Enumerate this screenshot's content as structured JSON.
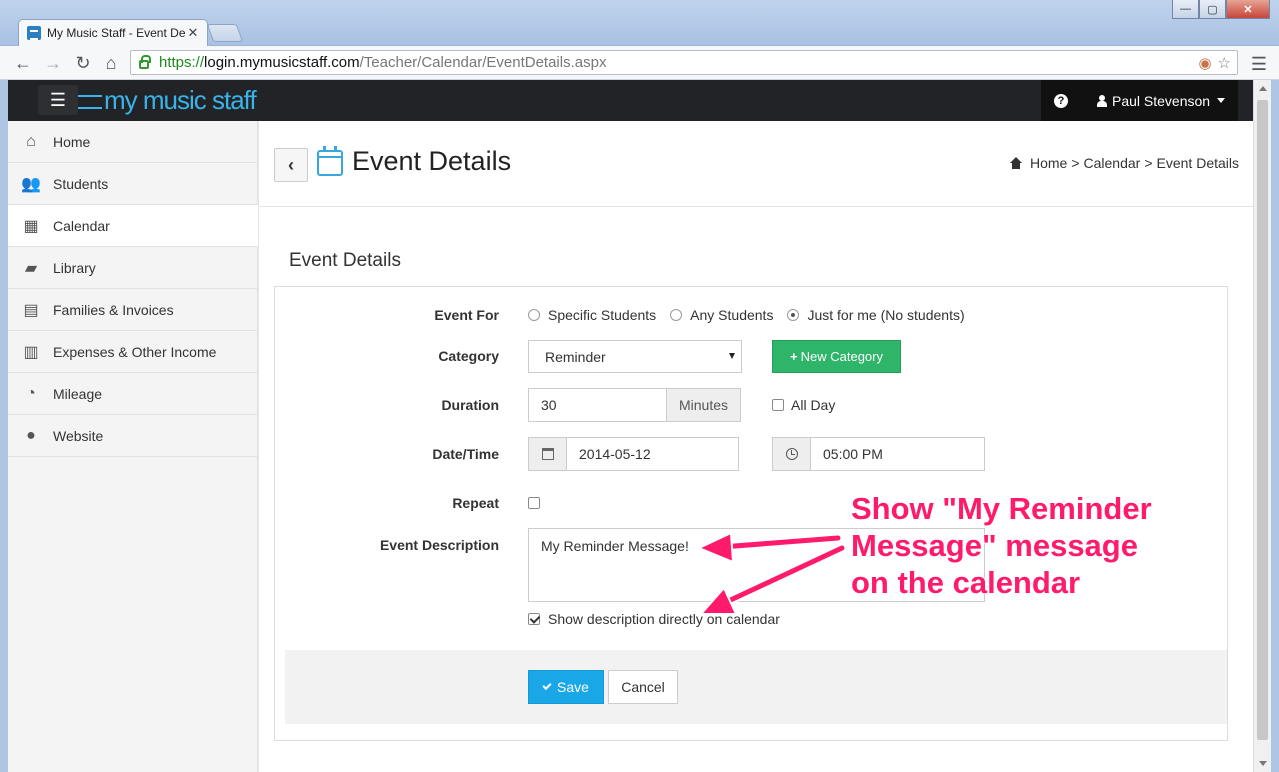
{
  "browser": {
    "tab_title": "My Music Staff - Event De",
    "tab_close": "✕",
    "url_scheme": "https://",
    "url_host": "login.mymusicstaff.com",
    "url_path": "/Teacher/Calendar/EventDetails.aspx",
    "window_controls": {
      "minimize": "—",
      "maximize": "▢",
      "close": "✕"
    }
  },
  "appbar": {
    "brand": "my music staff",
    "help": "?",
    "user_name": "Paul Stevenson"
  },
  "sidebar": {
    "items": [
      {
        "label": "Home",
        "icon": "home-icon"
      },
      {
        "label": "Students",
        "icon": "users-icon"
      },
      {
        "label": "Calendar",
        "icon": "calendar-icon",
        "active": true
      },
      {
        "label": "Library",
        "icon": "book-icon"
      },
      {
        "label": "Families & Invoices",
        "icon": "file-icon"
      },
      {
        "label": "Expenses & Other Income",
        "icon": "bar-chart-icon"
      },
      {
        "label": "Mileage",
        "icon": "dashboard-icon"
      },
      {
        "label": "Website",
        "icon": "globe-icon"
      }
    ]
  },
  "page": {
    "title": "Event Details",
    "breadcrumb": {
      "home": "Home",
      "sep1": ">",
      "calendar": "Calendar",
      "sep2": ">",
      "current": "Event Details"
    },
    "section_title": "Event Details"
  },
  "form": {
    "event_for": {
      "label": "Event For",
      "options": [
        "Specific Students",
        "Any Students",
        "Just for me (No students)"
      ],
      "selected": "Just for me (No students)"
    },
    "category": {
      "label": "Category",
      "value": "Reminder",
      "new_button": "New Category"
    },
    "duration": {
      "label": "Duration",
      "value": "30",
      "unit": "Minutes",
      "all_day_label": "All Day",
      "all_day_checked": false
    },
    "datetime": {
      "label": "Date/Time",
      "date": "2014-05-12",
      "time": "05:00 PM"
    },
    "repeat": {
      "label": "Repeat",
      "checked": false
    },
    "description": {
      "label": "Event Description",
      "value": "My Reminder Message!",
      "show_on_calendar_label": "Show description directly on calendar",
      "show_on_calendar_checked": true
    },
    "save_label": "Save",
    "cancel_label": "Cancel"
  },
  "annotation": {
    "lines": [
      "Show \"My Reminder",
      "Message\" message",
      "on the calendar"
    ],
    "color": "#ff1a6c"
  },
  "colors": {
    "accent_blue": "#1aa7e8",
    "green": "#2fb56a",
    "header_dark": "#222326"
  }
}
